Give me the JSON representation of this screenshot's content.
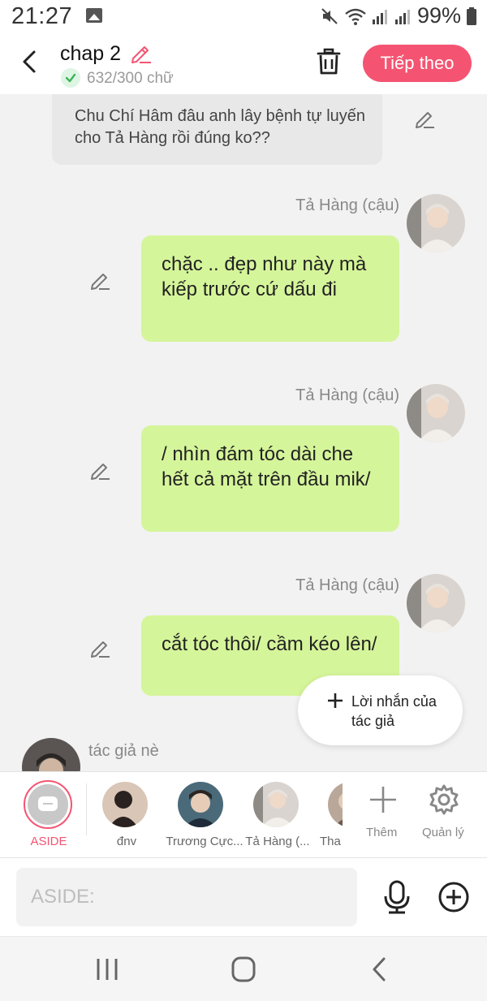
{
  "status_bar": {
    "time": "21:27",
    "battery_percent": "99%",
    "icons": [
      "image-icon",
      "mute-icon",
      "wifi-icon",
      "signal-icon",
      "signal-icon",
      "battery-icon"
    ]
  },
  "header": {
    "title": "chap 2",
    "word_count": "632/300 chữ",
    "next_label": "Tiếp theo"
  },
  "messages": [
    {
      "sender": "",
      "text": "Chu Chí Hâm đâu anh lây bệnh tự luyến cho Tả Hàng rồi đúng ko??"
    },
    {
      "sender": "Tả Hàng (cậu)",
      "text": "chặc .. đẹp như này mà kiếp trước cứ dấu đi"
    },
    {
      "sender": "Tả Hàng (cậu)",
      "text": "/ nhìn đám tóc dài che hết cả mặt trên đầu mik/"
    },
    {
      "sender": "Tả Hàng (cậu)",
      "text": "cắt tóc thôi/ cầm kéo lên/"
    }
  ],
  "author": {
    "name": "tác giả nè"
  },
  "author_note": {
    "label": "Lời nhắn của tác giả"
  },
  "characters": [
    {
      "label": "ASIDE"
    },
    {
      "label": "đnv"
    },
    {
      "label": "Trương Cực..."
    },
    {
      "label": "Tả Hàng (..."
    },
    {
      "label": "Tha"
    }
  ],
  "tools": {
    "add_label": "Thêm",
    "manage_label": "Quản lý"
  },
  "input": {
    "placeholder": "ASIDE:"
  },
  "colors": {
    "accent": "#f45472",
    "bubble": "#d5f59a",
    "aside_label": "#f45472"
  }
}
